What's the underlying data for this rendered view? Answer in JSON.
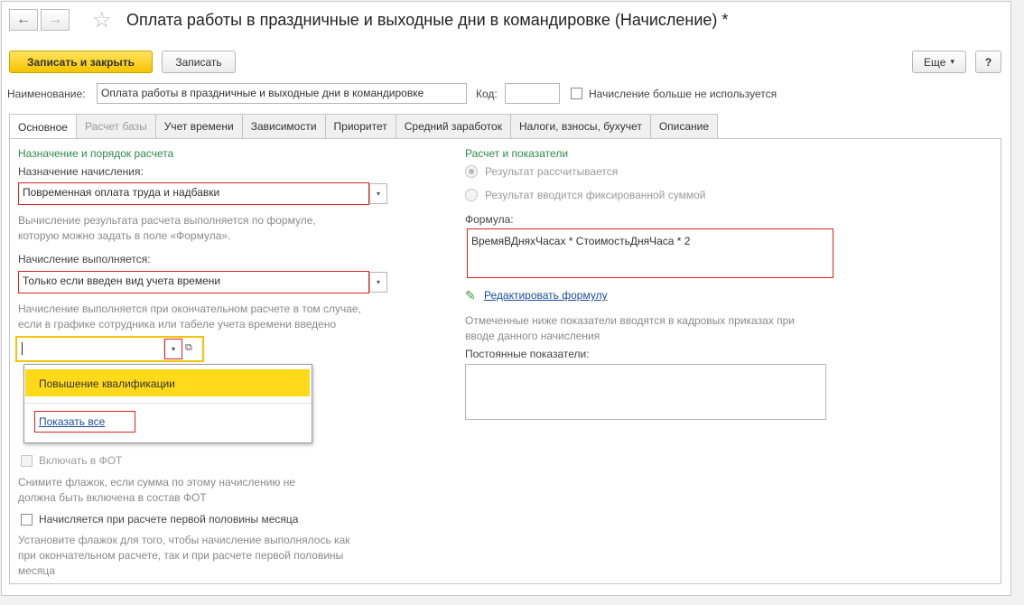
{
  "window": {
    "title": "Оплата работы в праздничные и выходные дни в командировке (Начисление) *",
    "nav_back": "←",
    "nav_forward": "→",
    "star": "☆"
  },
  "toolbar": {
    "save_close_label": "Записать и закрыть",
    "save_label": "Записать",
    "more_label": "Еще",
    "more_arrow": "▾",
    "help_label": "?"
  },
  "header": {
    "name_label": "Наименование:",
    "name_value": "Оплата работы в праздничные и выходные дни в командировке",
    "code_label": "Код:",
    "code_value": "",
    "unused_label": "Начисление больше не используется"
  },
  "tabs": [
    {
      "label": "Основное",
      "state": "active"
    },
    {
      "label": "Расчет базы",
      "state": "disabled"
    },
    {
      "label": "Учет времени",
      "state": "normal"
    },
    {
      "label": "Зависимости",
      "state": "normal"
    },
    {
      "label": "Приоритет",
      "state": "normal"
    },
    {
      "label": "Средний заработок",
      "state": "normal"
    },
    {
      "label": "Налоги, взносы, бухучет",
      "state": "normal"
    },
    {
      "label": "Описание",
      "state": "normal"
    }
  ],
  "left": {
    "section_title": "Назначение и порядок расчета",
    "purpose_label": "Назначение начисления:",
    "purpose_value": "Повременная оплата труда и надбавки",
    "purpose_note_1": "Вычисление результата расчета выполняется по формуле,",
    "purpose_note_2": "которую можно задать в поле «Формула».",
    "exec_label": "Начисление выполняется:",
    "exec_value": "Только если введен вид учета времени",
    "exec_note_1": "Начисление выполняется при окончательном расчете в том случае,",
    "exec_note_2": "если в графике сотрудника или табеле учета времени введено",
    "time_kind_value": "",
    "popup_item": "Повышение квалификации",
    "popup_show_all": "Показать все",
    "fot_label": "Включать в ФОТ",
    "fot_note_1": "Снимите флажок, если сумма по этому начислению не",
    "fot_note_2": "должна быть включена в состав ФОТ",
    "half_month_label": "Начисляется при расчете первой половины месяца",
    "half_note_1": "Установите флажок для того, чтобы начисление выполнялось как",
    "half_note_2": "при окончательном расчете, так и при расчете первой половины",
    "half_note_3": "месяца"
  },
  "right": {
    "section_title": "Расчет и показатели",
    "radio_calc": "Результат рассчитывается",
    "radio_fixed": "Результат вводится фиксированной суммой",
    "formula_label": "Формула:",
    "formula_value": "ВремяВДняхЧасах * СтоимостьДняЧаса * 2",
    "edit_formula_link": "Редактировать формулу",
    "indicators_note_1": "Отмеченные ниже показатели вводятся в кадровых приказах при",
    "indicators_note_2": "вводе данного начисления",
    "const_indicators_label": "Постоянные показатели:"
  },
  "icons": {
    "dropdown_arrow": "▾",
    "open_icon": "⧉",
    "pencil_icon": "✎"
  }
}
